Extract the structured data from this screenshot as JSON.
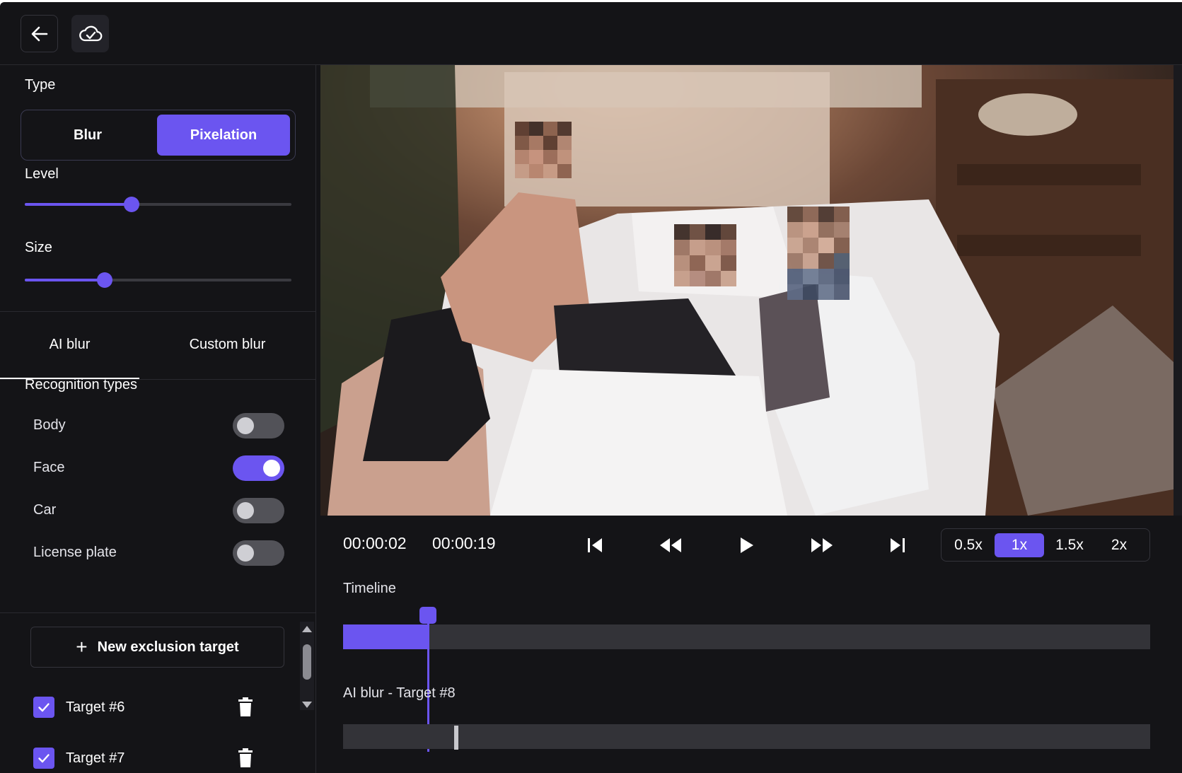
{
  "type_section": {
    "label": "Type",
    "options": [
      "Blur",
      "Pixelation"
    ],
    "selected": "Pixelation"
  },
  "level": {
    "label": "Level",
    "value": 0.4
  },
  "size": {
    "label": "Size",
    "value": 0.3
  },
  "tabs": {
    "ai": "AI blur",
    "custom": "Custom blur",
    "active": "AI blur"
  },
  "recognition": {
    "title": "Recognition types",
    "items": [
      {
        "label": "Body",
        "on": false
      },
      {
        "label": "Face",
        "on": true
      },
      {
        "label": "Car",
        "on": false
      },
      {
        "label": "License plate",
        "on": false
      }
    ]
  },
  "new_exclusion": {
    "label": "New exclusion target",
    "icon": "plus-icon"
  },
  "targets": [
    {
      "label": "Target #6",
      "checked": true
    },
    {
      "label": "Target #7",
      "checked": true
    }
  ],
  "player": {
    "current_time": "00:00:02",
    "total_time": "00:00:19",
    "progress": 0.105,
    "speeds": [
      "0.5x",
      "1x",
      "1.5x",
      "2x"
    ],
    "selected_speed": "1x"
  },
  "timeline": {
    "label": "Timeline",
    "track_label": "AI blur - Target #8"
  },
  "colors": {
    "accent": "#6b55f0",
    "background": "#141417",
    "track": "#333338"
  }
}
